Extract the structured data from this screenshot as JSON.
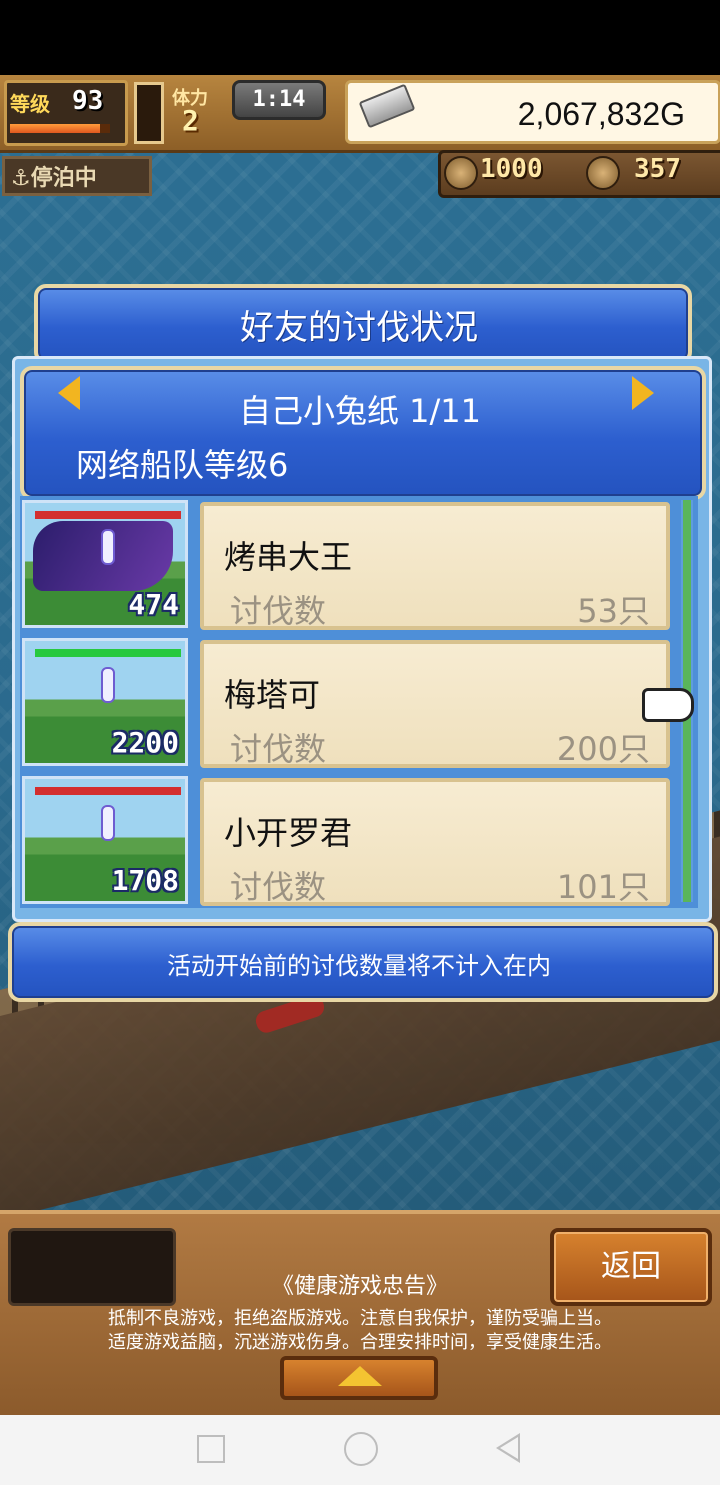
{
  "hud": {
    "level_label": "等级",
    "level": "93",
    "level_progress": 0.9,
    "stamina_label": "体力",
    "stamina": "2",
    "timer": "1:14",
    "gold": "2,067,832G",
    "status_badge": "⚓停泊中",
    "resource1": "1000",
    "resource2": "357"
  },
  "panel": {
    "title": "好友的讨伐状况",
    "player_name": "自己小兔纸 1/11",
    "fleet_level": "网络船队等级6",
    "kill_label": "讨伐数",
    "rows": [
      {
        "boss_count": "474",
        "hp_color": "#d32f2f",
        "name": "烤串大王",
        "kills": "53只"
      },
      {
        "boss_count": "2200",
        "hp_color": "#27c93f",
        "name": "梅塔可",
        "kills": "200只"
      },
      {
        "boss_count": "1708",
        "hp_color": "#d32f2f",
        "name": "小开罗君",
        "kills": "101只"
      }
    ],
    "note": "活动开始前的讨伐数量将不计入在内"
  },
  "bottom": {
    "back_label": "返回",
    "health_title": "《健康游戏忠告》",
    "health_line1": "抵制不良游戏，拒绝盗版游戏。注意自我保护，谨防受骗上当。",
    "health_line2": "适度游戏益脑，沉迷游戏伤身。合理安排时间，享受健康生活。"
  }
}
